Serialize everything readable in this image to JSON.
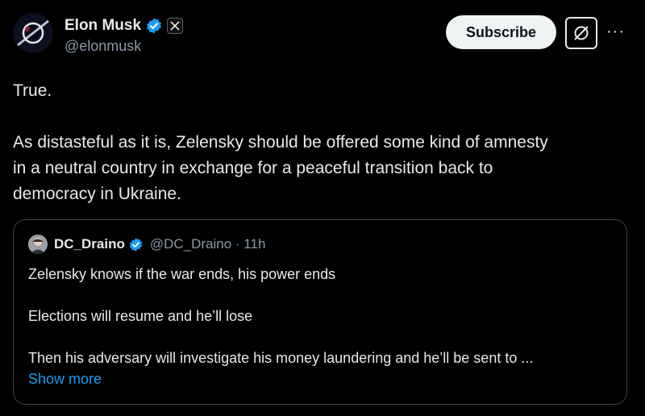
{
  "author": {
    "name": "Elon Musk",
    "handle": "@elonmusk",
    "avatar_icon": "avatar-image",
    "verified_icon": "verified-badge-icon",
    "affiliate_icon": "x-logo-icon"
  },
  "actions": {
    "subscribe_label": "Subscribe",
    "grok_icon": "grok-icon",
    "more_label": "···"
  },
  "post": {
    "lines": [
      "True.",
      "As distasteful as it is, Zelensky should be offered some kind of amnesty",
      "in a neutral country in exchange for a peaceful transition back to",
      "democracy in Ukraine."
    ]
  },
  "quote": {
    "name": "DC_Draino",
    "handle_time": "@DC_Draino · 11h",
    "lines": [
      "Zelensky knows if the war ends, his power ends",
      "Elections will resume and he’ll lose",
      "Then his adversary will investigate his money laundering and he’ll be sent to ..."
    ],
    "show_more": "Show more"
  },
  "colors": {
    "background": "#000000",
    "text": "#e7e9ea",
    "secondary": "#8b98a5",
    "link": "#1d9bf0",
    "verified": "#1d9bf0",
    "border": "#3a3f44"
  }
}
